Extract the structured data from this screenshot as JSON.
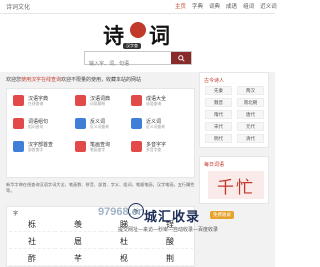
{
  "site": {
    "name": "诗词文化"
  },
  "nav": [
    "主页",
    "字典",
    "词典",
    "成语",
    "组词",
    "近义词"
  ],
  "logo": {
    "left": "诗",
    "right": "词",
    "sub": "汉字查"
  },
  "search": {
    "placeholder": "输入字、词、句语"
  },
  "notice": {
    "prefix": "欢迎您",
    "highlight": "使用汉字在线查询",
    "text": "欢迎不限量的使用，收藏本站的网站"
  },
  "tools": [
    {
      "title": "汉语字典",
      "desc": "在线查询",
      "color": "#e24a4a"
    },
    {
      "title": "汉语词典",
      "desc": "词语解释",
      "color": "#e24a4a"
    },
    {
      "title": "成语大全",
      "desc": "成语查询",
      "color": "#e24a4a"
    },
    {
      "title": "词语组句",
      "desc": "组词造句",
      "color": "#e24a4a"
    },
    {
      "title": "反义词",
      "desc": "反义词查询",
      "color": "#3f7fd8"
    },
    {
      "title": "近义词",
      "desc": "近义词查询",
      "color": "#3f7fd8"
    },
    {
      "title": "汉字部首查",
      "desc": "部首查字",
      "color": "#3f7fd8"
    },
    {
      "title": "笔画查询",
      "desc": "笔画查字",
      "color": "#e24a4a"
    },
    {
      "title": "多音字字",
      "desc": "多音字查",
      "color": "#e24a4a"
    }
  ],
  "intro": "新华字典在线查询汉语字词大全，笔画数、拼音、部首、字义、组词，笔顺笔画，汉字笔画，五行属性等。",
  "grid": {
    "header": "字",
    "chars": [
      "栎",
      "羡",
      "睇",
      "锃",
      "社",
      "扈",
      "杜",
      "酸",
      "酢",
      "芊",
      "枧",
      "荆"
    ]
  },
  "sidebar": {
    "dynasty_header": "古今诗人",
    "dynasties": [
      "先秦",
      "两汉",
      "魏晋",
      "南北朝",
      "隋代",
      "唐代",
      "宋代",
      "元代",
      "明代",
      "清代"
    ],
    "daily_header": "每日词语",
    "daily_word": "千忙"
  },
  "watermark": {
    "num": "97968.cn",
    "seal": "坂",
    "big": "城汇收录",
    "badge": "免费收录",
    "small": "提交网址—来访—秒审—自动收录—百度收录"
  }
}
